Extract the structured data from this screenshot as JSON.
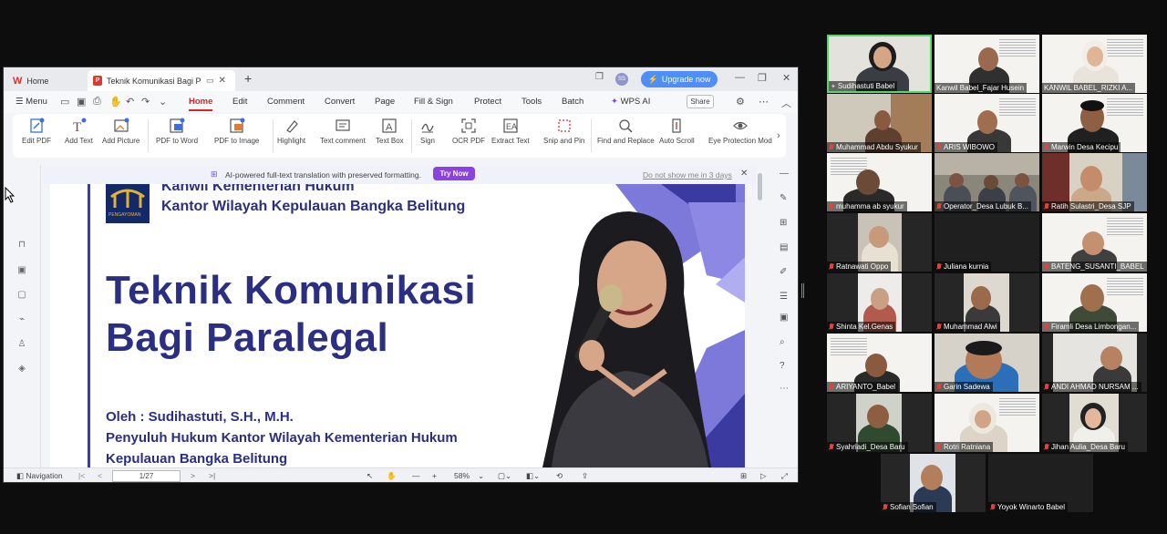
{
  "app": {
    "tabs": [
      {
        "label": "Home"
      },
      {
        "label": "Teknik Komunikasi Bagi Paralegal"
      }
    ],
    "upgrade_label": "Upgrade now",
    "avatar_initials": "SS",
    "accent_color": "#d6262b"
  },
  "menu": {
    "menu_label": "Menu",
    "items": [
      "Home",
      "Edit",
      "Comment",
      "Convert",
      "Page",
      "Fill & Sign",
      "Protect",
      "Tools",
      "Batch"
    ],
    "wps_ai_label": "WPS AI",
    "share_label": "Share"
  },
  "ribbon": {
    "buttons": [
      "Edit PDF",
      "Add Text",
      "Add Picture",
      "PDF to Word",
      "PDF to Image",
      "Highlight",
      "Text comment",
      "Text Box",
      "Sign",
      "OCR PDF",
      "Extract Text",
      "Snip and Pin",
      "Find and Replace",
      "Auto Scroll",
      "Eye Protection Mod"
    ]
  },
  "banner": {
    "message": "AI-powered full-text translation with preserved formatting.",
    "try_label": "Try Now",
    "dismiss_label": "Do not show me in 3 days"
  },
  "slide": {
    "org_line1": "Kanwil Kementerian Hukum",
    "org_line2": "Kantor Wilayah Kepulauan Bangka Belitung",
    "logo_caption": "PENGAYOMAN",
    "title_line1": "Teknik Komunikasi",
    "title_line2": "Bagi Paralegal",
    "byline1": "Oleh : Sudihastuti, S.H., M.H.",
    "byline2": "Penyuluh Hukum Kantor Wilayah Kementerian Hukum",
    "byline3": "Kepulauan Bangka Belitung"
  },
  "status": {
    "navigation_label": "Navigation",
    "page_indicator": "1/27",
    "zoom_level": "58%"
  },
  "participants": [
    {
      "name": "Sudihastuti Babel",
      "muted": false,
      "active": true
    },
    {
      "name": "Kanwil Babel_Fajar Husein",
      "muted": false
    },
    {
      "name": "KANWIL BABEL_RIZKI A...",
      "muted": false
    },
    {
      "name": "Muhammad Abdu Syukur",
      "muted": true
    },
    {
      "name": "ARIS WIBOWO",
      "muted": true
    },
    {
      "name": "Marwin Desa Kecipu",
      "muted": true
    },
    {
      "name": "muhamma ab syukur",
      "muted": true
    },
    {
      "name": "Operator_Desa Lubuk B...",
      "muted": true
    },
    {
      "name": "Ratih Sulastri_Desa SJP",
      "muted": true
    },
    {
      "name": "Ratnawati Oppo",
      "muted": true
    },
    {
      "name": "Juliana kurnia",
      "muted": true
    },
    {
      "name": "BATENG_SUSANTI_BABEL",
      "muted": true
    },
    {
      "name": "Shinta Kel.Genas",
      "muted": true
    },
    {
      "name": "Muhammad Alwi",
      "muted": true
    },
    {
      "name": "Firamli Desa Limbongan...",
      "muted": true
    },
    {
      "name": "ARIYANTO_Babel",
      "muted": true
    },
    {
      "name": "Garin Sadewa",
      "muted": true
    },
    {
      "name": "ANDI AHMAD NURSAM ...",
      "muted": true
    },
    {
      "name": "Syahriadi_Desa Baru",
      "muted": true
    },
    {
      "name": "Rotri Ratniana",
      "muted": true
    },
    {
      "name": "Jihan Aulia_Desa Baru",
      "muted": true
    },
    {
      "name": "Sofian Sofian",
      "muted": true
    },
    {
      "name": "Yoyok Winarto  Babel",
      "muted": true
    }
  ]
}
